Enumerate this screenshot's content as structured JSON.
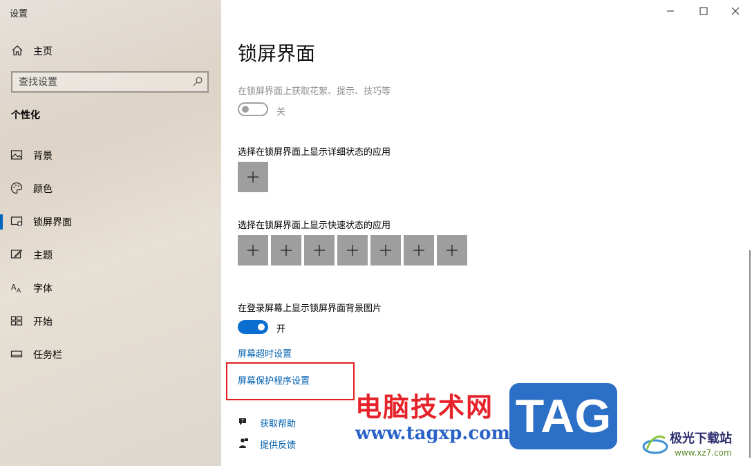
{
  "window": {
    "title": "设置"
  },
  "sidebar": {
    "home_label": "主页",
    "search_placeholder": "查找设置",
    "section_title": "个性化",
    "items": [
      {
        "label": "背景",
        "icon": "picture-icon"
      },
      {
        "label": "颜色",
        "icon": "palette-icon"
      },
      {
        "label": "锁屏界面",
        "icon": "lock-screen-icon",
        "active": true
      },
      {
        "label": "主题",
        "icon": "theme-icon"
      },
      {
        "label": "字体",
        "icon": "font-icon"
      },
      {
        "label": "开始",
        "icon": "start-icon"
      },
      {
        "label": "任务栏",
        "icon": "taskbar-icon"
      }
    ]
  },
  "main": {
    "page_title": "锁屏界面",
    "fun_facts_label": "在锁屏界面上获取花絮、提示、技巧等",
    "fun_facts_toggle": "关",
    "detailed_status_label": "选择在锁屏界面上显示详细状态的应用",
    "quick_status_label": "选择在锁屏界面上显示快速状态的应用",
    "quick_status_slots": 7,
    "signin_bg_label": "在登录屏幕上显示锁屏界面背景图片",
    "signin_bg_toggle": "开",
    "screen_timeout_link": "屏幕超时设置",
    "screensaver_link": "屏幕保护程序设置",
    "get_help": "获取帮助",
    "give_feedback": "提供反馈"
  },
  "watermark": {
    "site_cn": "电脑技术网",
    "site_url": "www.tagxp.com",
    "tag_text": "TAG",
    "logo_name": "极光下载站",
    "logo_url": "www.xz7.com"
  },
  "colors": {
    "accent": "#0a6ed1",
    "link": "#0060b0",
    "highlight": "#e02020",
    "add_button": "#9e9e9e"
  }
}
